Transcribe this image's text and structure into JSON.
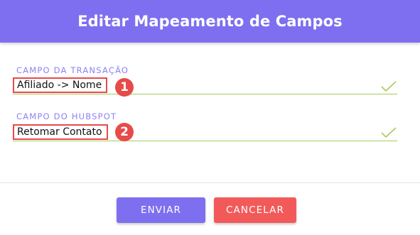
{
  "dialog": {
    "title": "Editar Mapeamento de Campos"
  },
  "fields": {
    "transaction": {
      "label": "CAMPO DA TRANSAÇÃO",
      "value": "Afiliado -> Nome",
      "badge": "1"
    },
    "hubspot": {
      "label": "CAMPO DO HUBSPOT",
      "value": "Retomar Contato",
      "badge": "2"
    }
  },
  "actions": {
    "send_label": "ENVIAR",
    "cancel_label": "CANCELAR"
  },
  "icons": {
    "valid": "check-icon"
  },
  "colors": {
    "primary": "#7e6ff0",
    "danger": "#f25a5a",
    "highlight": "#e84a4a",
    "valid": "#a6cc5c",
    "label": "#8d80f3"
  }
}
